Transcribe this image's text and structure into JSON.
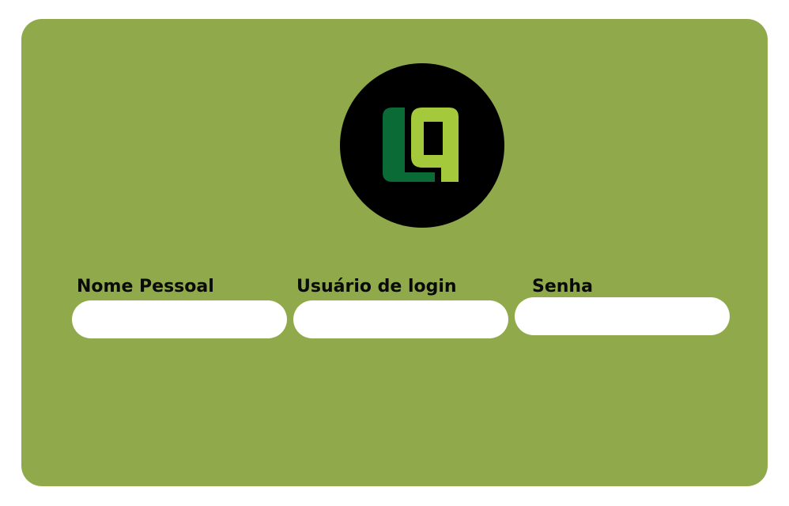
{
  "form": {
    "logo": {
      "icon": "lq-logo-icon",
      "colors": {
        "circle": "#000000",
        "left_shape": "#0a6b36",
        "right_shape": "#a4c93a"
      }
    },
    "fields": [
      {
        "label": "Nome Pessoal",
        "value": "",
        "placeholder": ""
      },
      {
        "label": "Usuário de login",
        "value": "",
        "placeholder": ""
      },
      {
        "label": "Senha",
        "value": "",
        "placeholder": ""
      }
    ]
  },
  "colors": {
    "page_background": "#ffffff",
    "card_background": "#90aa4b",
    "input_background": "#ffffff",
    "label_text": "#0a0a0a"
  }
}
